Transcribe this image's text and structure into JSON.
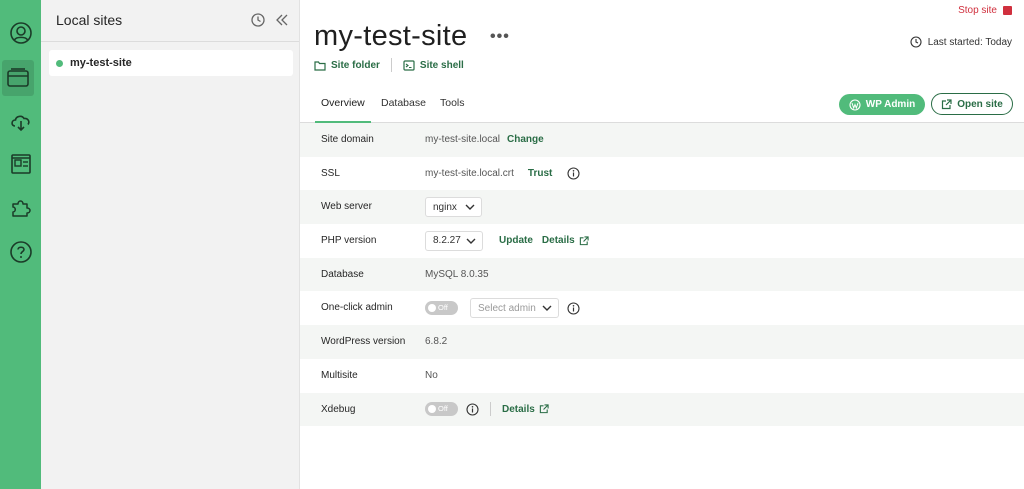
{
  "sidebar": {
    "title": "Local sites",
    "sites": [
      {
        "name": "my-test-site",
        "status": "running"
      }
    ]
  },
  "header": {
    "site_title": "my-test-site",
    "more_label": "•••",
    "stop_label": "Stop site",
    "last_started": "Last started: Today",
    "site_folder_label": "Site folder",
    "site_shell_label": "Site shell"
  },
  "tabs": [
    {
      "label": "Overview",
      "active": true
    },
    {
      "label": "Database",
      "active": false
    },
    {
      "label": "Tools",
      "active": false
    }
  ],
  "actions": {
    "wp_admin": "WP Admin",
    "open_site": "Open site"
  },
  "rows": {
    "site_domain": {
      "label": "Site domain",
      "value": "my-test-site.local",
      "action": "Change"
    },
    "ssl": {
      "label": "SSL",
      "value": "my-test-site.local.crt",
      "action": "Trust"
    },
    "web_server": {
      "label": "Web server",
      "value": "nginx"
    },
    "php_version": {
      "label": "PHP version",
      "value": "8.2.27",
      "update": "Update",
      "details": "Details"
    },
    "database": {
      "label": "Database",
      "value": "MySQL 8.0.35"
    },
    "one_click_admin": {
      "label": "One-click admin",
      "toggle": "Off",
      "placeholder": "Select admin"
    },
    "wordpress_version": {
      "label": "WordPress version",
      "value": "6.8.2"
    },
    "multisite": {
      "label": "Multisite",
      "value": "No"
    },
    "xdebug": {
      "label": "Xdebug",
      "toggle": "Off",
      "details": "Details"
    }
  },
  "colors": {
    "accent": "#51bb7b",
    "link": "#2a6d46",
    "danger": "#d0303e"
  },
  "icons": [
    "user-icon",
    "sites-icon",
    "cloud-icon",
    "blueprints-icon",
    "addons-icon",
    "help-icon",
    "history-icon",
    "collapse-icon",
    "folder-icon",
    "terminal-icon",
    "wordpress-icon",
    "external-link-icon",
    "clock-icon",
    "info-icon",
    "chevron-down-icon"
  ]
}
